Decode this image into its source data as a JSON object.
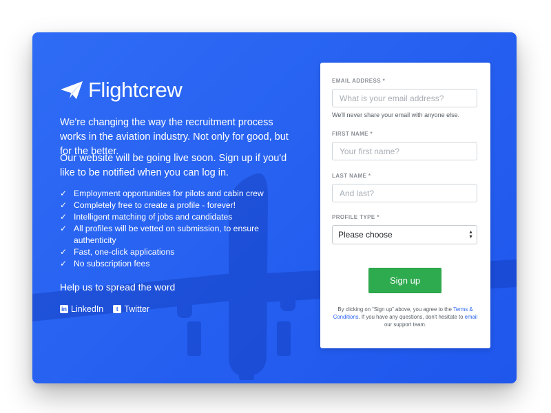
{
  "brand": {
    "name": "Flightcrew",
    "logo_icon": "paper-plane-icon"
  },
  "intro": {
    "paragraph1": "We're changing the way the recruitment process works in the aviation industry. Not only for good, but for the better.",
    "paragraph2": "Our website will be going live soon. Sign up if you'd like to be notified when you can log in."
  },
  "features": [
    "Employment opportunities for pilots and cabin crew",
    "Completely free to create a profile - forever!",
    "Intelligent matching of jobs and candidates",
    "All profiles will be vetted on submission, to ensure authenticity",
    "Fast, one-click applications",
    "No subscription fees"
  ],
  "spread": {
    "title": "Help us to spread the word",
    "linkedin": "LinkedIn",
    "twitter": "Twitter"
  },
  "form": {
    "email": {
      "label": "EMAIL ADDRESS *",
      "placeholder": "What is your email address?",
      "help": "We'll never share your email with anyone else."
    },
    "first_name": {
      "label": "FIRST NAME *",
      "placeholder": "Your first name?"
    },
    "last_name": {
      "label": "LAST NAME *",
      "placeholder": "And last?"
    },
    "profile_type": {
      "label": "PROFILE TYPE *",
      "selected": "Please choose"
    },
    "submit_label": "Sign up",
    "terms": {
      "before": "By clicking on “Sign up” above, you agree to the ",
      "link": "Terms & Conditions",
      "middle": ". If you have any questions, don't hesitate to ",
      "email_link": "email",
      "after": " our support team."
    }
  },
  "colors": {
    "background": "#2563f0",
    "button": "#2eaa4f",
    "link": "#2a63f2"
  },
  "background_image": "airplane-photo"
}
